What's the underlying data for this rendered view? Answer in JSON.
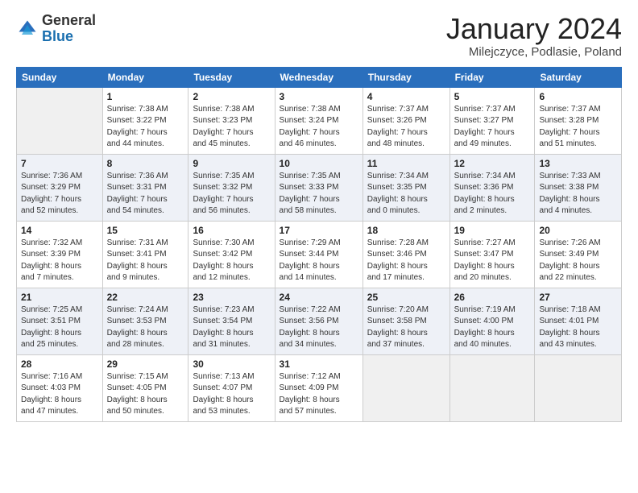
{
  "header": {
    "logo_general": "General",
    "logo_blue": "Blue",
    "month_title": "January 2024",
    "location": "Milejczyce, Podlasie, Poland"
  },
  "weekdays": [
    "Sunday",
    "Monday",
    "Tuesday",
    "Wednesday",
    "Thursday",
    "Friday",
    "Saturday"
  ],
  "weeks": [
    [
      {
        "day": "",
        "info": ""
      },
      {
        "day": "1",
        "info": "Sunrise: 7:38 AM\nSunset: 3:22 PM\nDaylight: 7 hours\nand 44 minutes."
      },
      {
        "day": "2",
        "info": "Sunrise: 7:38 AM\nSunset: 3:23 PM\nDaylight: 7 hours\nand 45 minutes."
      },
      {
        "day": "3",
        "info": "Sunrise: 7:38 AM\nSunset: 3:24 PM\nDaylight: 7 hours\nand 46 minutes."
      },
      {
        "day": "4",
        "info": "Sunrise: 7:37 AM\nSunset: 3:26 PM\nDaylight: 7 hours\nand 48 minutes."
      },
      {
        "day": "5",
        "info": "Sunrise: 7:37 AM\nSunset: 3:27 PM\nDaylight: 7 hours\nand 49 minutes."
      },
      {
        "day": "6",
        "info": "Sunrise: 7:37 AM\nSunset: 3:28 PM\nDaylight: 7 hours\nand 51 minutes."
      }
    ],
    [
      {
        "day": "7",
        "info": "Sunrise: 7:36 AM\nSunset: 3:29 PM\nDaylight: 7 hours\nand 52 minutes."
      },
      {
        "day": "8",
        "info": "Sunrise: 7:36 AM\nSunset: 3:31 PM\nDaylight: 7 hours\nand 54 minutes."
      },
      {
        "day": "9",
        "info": "Sunrise: 7:35 AM\nSunset: 3:32 PM\nDaylight: 7 hours\nand 56 minutes."
      },
      {
        "day": "10",
        "info": "Sunrise: 7:35 AM\nSunset: 3:33 PM\nDaylight: 7 hours\nand 58 minutes."
      },
      {
        "day": "11",
        "info": "Sunrise: 7:34 AM\nSunset: 3:35 PM\nDaylight: 8 hours\nand 0 minutes."
      },
      {
        "day": "12",
        "info": "Sunrise: 7:34 AM\nSunset: 3:36 PM\nDaylight: 8 hours\nand 2 minutes."
      },
      {
        "day": "13",
        "info": "Sunrise: 7:33 AM\nSunset: 3:38 PM\nDaylight: 8 hours\nand 4 minutes."
      }
    ],
    [
      {
        "day": "14",
        "info": "Sunrise: 7:32 AM\nSunset: 3:39 PM\nDaylight: 8 hours\nand 7 minutes."
      },
      {
        "day": "15",
        "info": "Sunrise: 7:31 AM\nSunset: 3:41 PM\nDaylight: 8 hours\nand 9 minutes."
      },
      {
        "day": "16",
        "info": "Sunrise: 7:30 AM\nSunset: 3:42 PM\nDaylight: 8 hours\nand 12 minutes."
      },
      {
        "day": "17",
        "info": "Sunrise: 7:29 AM\nSunset: 3:44 PM\nDaylight: 8 hours\nand 14 minutes."
      },
      {
        "day": "18",
        "info": "Sunrise: 7:28 AM\nSunset: 3:46 PM\nDaylight: 8 hours\nand 17 minutes."
      },
      {
        "day": "19",
        "info": "Sunrise: 7:27 AM\nSunset: 3:47 PM\nDaylight: 8 hours\nand 20 minutes."
      },
      {
        "day": "20",
        "info": "Sunrise: 7:26 AM\nSunset: 3:49 PM\nDaylight: 8 hours\nand 22 minutes."
      }
    ],
    [
      {
        "day": "21",
        "info": "Sunrise: 7:25 AM\nSunset: 3:51 PM\nDaylight: 8 hours\nand 25 minutes."
      },
      {
        "day": "22",
        "info": "Sunrise: 7:24 AM\nSunset: 3:53 PM\nDaylight: 8 hours\nand 28 minutes."
      },
      {
        "day": "23",
        "info": "Sunrise: 7:23 AM\nSunset: 3:54 PM\nDaylight: 8 hours\nand 31 minutes."
      },
      {
        "day": "24",
        "info": "Sunrise: 7:22 AM\nSunset: 3:56 PM\nDaylight: 8 hours\nand 34 minutes."
      },
      {
        "day": "25",
        "info": "Sunrise: 7:20 AM\nSunset: 3:58 PM\nDaylight: 8 hours\nand 37 minutes."
      },
      {
        "day": "26",
        "info": "Sunrise: 7:19 AM\nSunset: 4:00 PM\nDaylight: 8 hours\nand 40 minutes."
      },
      {
        "day": "27",
        "info": "Sunrise: 7:18 AM\nSunset: 4:01 PM\nDaylight: 8 hours\nand 43 minutes."
      }
    ],
    [
      {
        "day": "28",
        "info": "Sunrise: 7:16 AM\nSunset: 4:03 PM\nDaylight: 8 hours\nand 47 minutes."
      },
      {
        "day": "29",
        "info": "Sunrise: 7:15 AM\nSunset: 4:05 PM\nDaylight: 8 hours\nand 50 minutes."
      },
      {
        "day": "30",
        "info": "Sunrise: 7:13 AM\nSunset: 4:07 PM\nDaylight: 8 hours\nand 53 minutes."
      },
      {
        "day": "31",
        "info": "Sunrise: 7:12 AM\nSunset: 4:09 PM\nDaylight: 8 hours\nand 57 minutes."
      },
      {
        "day": "",
        "info": ""
      },
      {
        "day": "",
        "info": ""
      },
      {
        "day": "",
        "info": ""
      }
    ]
  ]
}
